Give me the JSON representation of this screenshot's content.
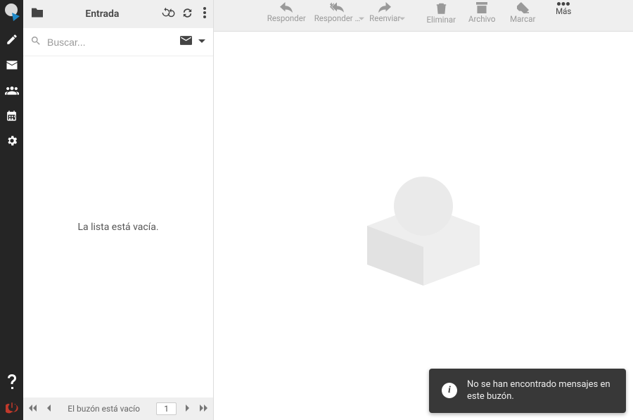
{
  "rail": {
    "items": [
      "logo",
      "compose",
      "mail",
      "contacts",
      "calendar",
      "settings"
    ],
    "bottom": [
      "help",
      "logout"
    ]
  },
  "list": {
    "title": "Entrada",
    "search_placeholder": "Buscar...",
    "empty_message": "La lista está vacía.",
    "footer_status": "El buzón está vacío",
    "page_number": "1"
  },
  "toolbar": {
    "reply": "Responder",
    "reply_all": "Responder …",
    "forward": "Reenviar",
    "delete": "Eliminar",
    "archive": "Archivo",
    "mark": "Marcar",
    "more": "Más"
  },
  "toast": {
    "message": "No se han encontrado mensajes en este buzón."
  }
}
